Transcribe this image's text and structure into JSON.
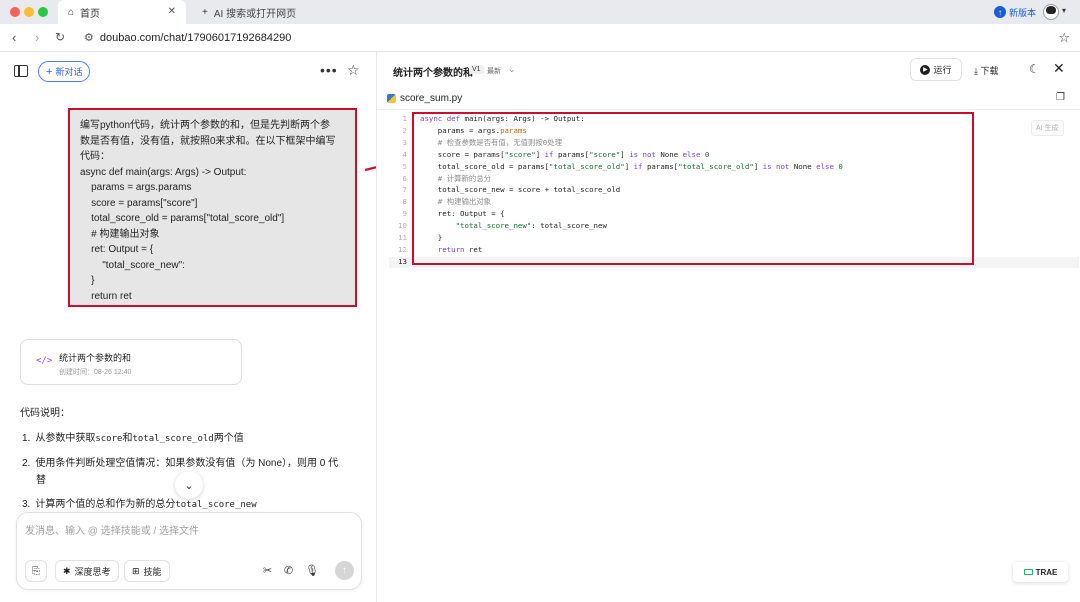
{
  "browser": {
    "tabs": [
      {
        "label": "首页",
        "icon": "home-icon"
      },
      {
        "label": "AI 搜索或打开网页",
        "icon": "plus-icon"
      }
    ],
    "new_version_label": "新版本",
    "url": "doubao.com/chat/17906017192684290"
  },
  "chat": {
    "new_chat_label": "新对话",
    "user_message_lines": [
      "编写python代码，统计两个参数的和，但是先判断两个参",
      "数是否有值，没有值，就按照0来求和。在以下框架中编写",
      "代码：",
      "async def main(args: Args) -> Output:",
      "    params = args.params",
      "    score = params[\"score\"]",
      "    total_score_old = params[\"total_score_old\"]",
      "    # 构建输出对象",
      "    ret: Output = {",
      "        \"total_score_new\":",
      "    }",
      "    return ret"
    ],
    "code_card": {
      "title": "统计两个参数的和",
      "created": "创建时间：08-26 12:40"
    },
    "explanation_heading": "代码说明：",
    "explanation_items": [
      {
        "num": "1.",
        "pre": "从参数中获取",
        "code1": "score",
        "mid": "和",
        "code2": "total_score_old",
        "post": "两个值"
      },
      {
        "num": "2.",
        "pre": "使用条件判断处理空值情况：如果参数没有值（为 None），则用 0 代",
        "code1": "",
        "mid": "",
        "code2": "",
        "post": ""
      },
      {
        "num": "",
        "pre": "替",
        "code1": "",
        "mid": "",
        "code2": "",
        "post": ""
      },
      {
        "num": "3.",
        "pre": "计算两个值的总和作为新的总分",
        "code1": "total_score_new",
        "mid": "",
        "code2": "",
        "post": ""
      }
    ],
    "composer": {
      "placeholder": "发消息、输入 @ 选择技能或 / 选择文件",
      "deep_think_label": "深度思考",
      "skills_label": "技能"
    }
  },
  "editor": {
    "title": "统计两个参数的和",
    "version": "V1",
    "latest": "最新",
    "run_label": "运行",
    "download_label": "下载",
    "file_name": "score_sum.py",
    "ai_generate_label": "AI 生成",
    "current_line": 13,
    "lines": [
      [
        [
          "kw",
          "async def "
        ],
        [
          "op",
          "main(args: Args) -> Output:"
        ]
      ],
      [
        [
          "op",
          "    params = args."
        ],
        [
          "attr",
          "params"
        ]
      ],
      [
        [
          "cm",
          "    # 检查参数是否有值，无值则按0处理"
        ]
      ],
      [
        [
          "op",
          "    score = params["
        ],
        [
          "str",
          "\"score\""
        ],
        [
          "op",
          "] "
        ],
        [
          "kw",
          "if "
        ],
        [
          "op",
          "params["
        ],
        [
          "str",
          "\"score\""
        ],
        [
          "op",
          "] "
        ],
        [
          "kw",
          "is not "
        ],
        [
          "op",
          "None "
        ],
        [
          "kw",
          "else "
        ],
        [
          "str",
          "0"
        ]
      ],
      [
        [
          "op",
          "    total_score_old = params["
        ],
        [
          "str",
          "\"total_score_old\""
        ],
        [
          "op",
          "] "
        ],
        [
          "kw",
          "if "
        ],
        [
          "op",
          "params["
        ],
        [
          "str",
          "\"total_score_old\""
        ],
        [
          "op",
          "] "
        ],
        [
          "kw",
          "is not "
        ],
        [
          "op",
          "None "
        ],
        [
          "kw",
          "else "
        ],
        [
          "str",
          "0"
        ]
      ],
      [
        [
          "cm",
          "    # 计算新的总分"
        ]
      ],
      [
        [
          "op",
          "    total_score_new = score + total_score_old"
        ]
      ],
      [
        [
          "cm",
          "    # 构建输出对象"
        ]
      ],
      [
        [
          "op",
          "    ret: Output = {"
        ]
      ],
      [
        [
          "str",
          "        \"total_score_new\""
        ],
        [
          "op",
          ": total_score_new"
        ]
      ],
      [
        [
          "op",
          "    }"
        ]
      ],
      [
        [
          "kw",
          "    return "
        ],
        [
          "op",
          "ret"
        ]
      ],
      []
    ]
  },
  "badge": {
    "label": "TRAE"
  },
  "colors": {
    "highlight_box": "#c8102e",
    "accent": "#2b5be8",
    "keyword": "#7a3fc8",
    "string": "#1a6b2e"
  }
}
